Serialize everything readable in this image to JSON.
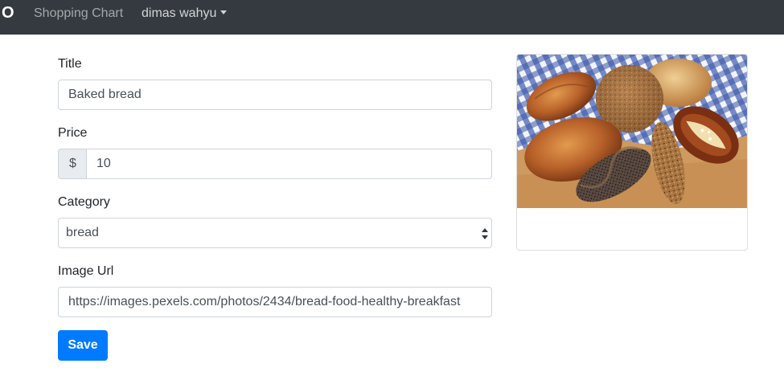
{
  "navbar": {
    "brand": "O",
    "links": [
      {
        "label": "Shopping Chart"
      },
      {
        "label": "dimas wahyu"
      }
    ]
  },
  "form": {
    "title": {
      "label": "Title",
      "value": "Baked bread"
    },
    "price": {
      "label": "Price",
      "currency": "$",
      "value": "10"
    },
    "category": {
      "label": "Category",
      "selected": "bread"
    },
    "image_url": {
      "label": "Image Url",
      "value": "https://images.pexels.com/photos/2434/bread-food-healthy-breakfast"
    },
    "save_label": "Save"
  },
  "colors": {
    "navbar": "#343a40",
    "primary": "#007bff",
    "addon_bg": "#e9ecef"
  }
}
